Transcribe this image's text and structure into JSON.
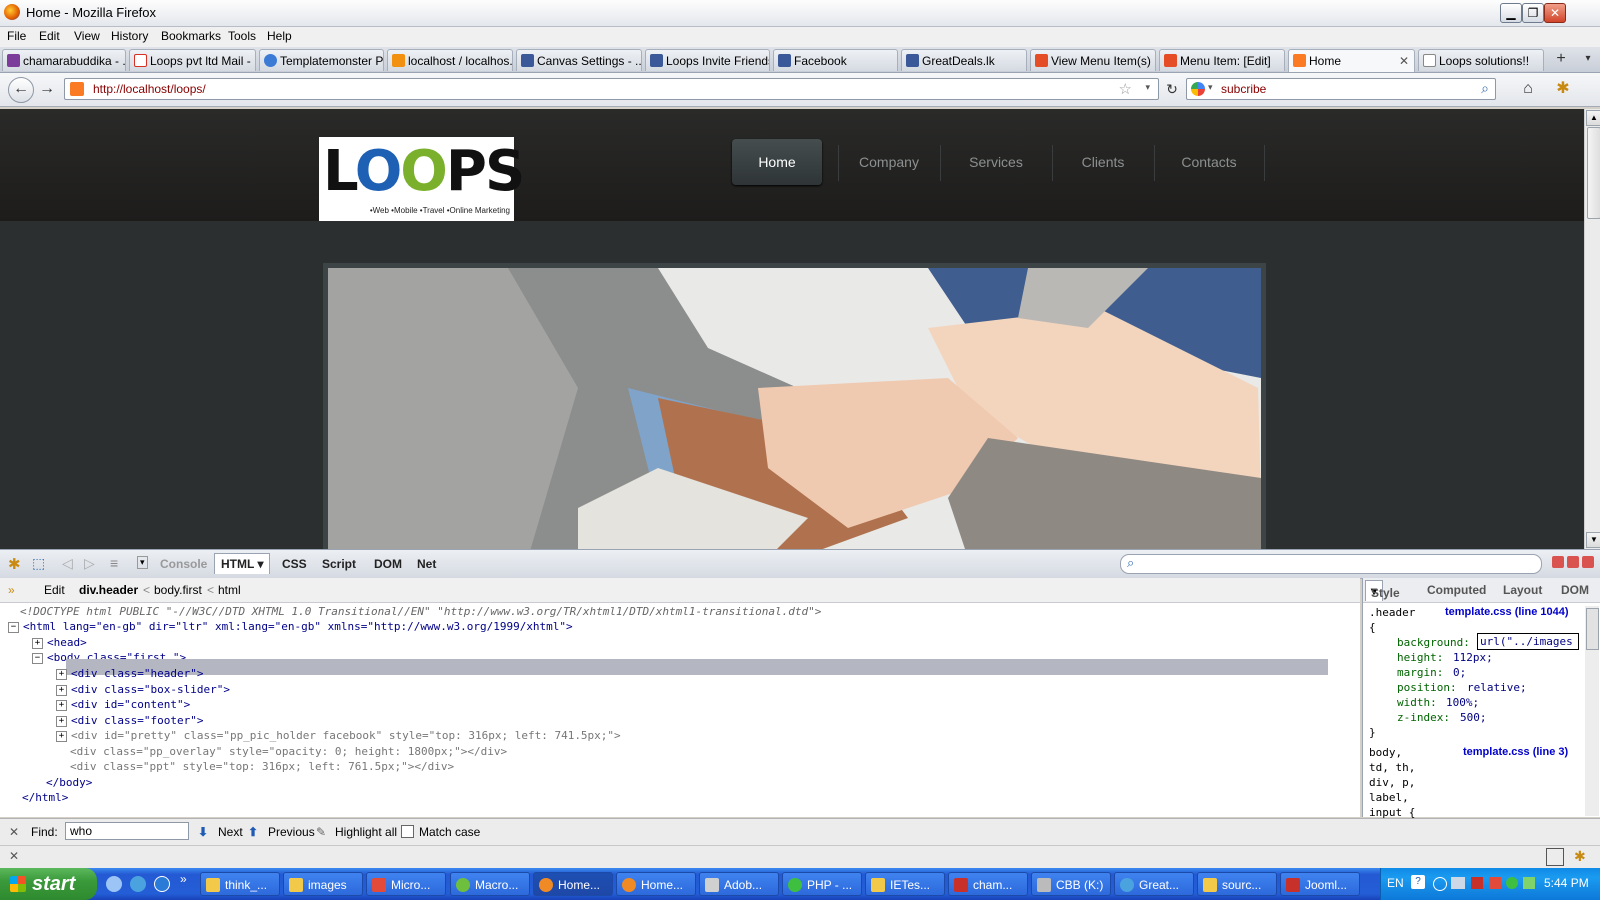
{
  "window": {
    "title": "Home - Mozilla Firefox"
  },
  "menubar": [
    "File",
    "Edit",
    "View",
    "History",
    "Bookmarks",
    "Tools",
    "Help"
  ],
  "tabs": [
    {
      "label": "chamarabuddika - ...",
      "icon": "mail-icon",
      "color": "#7b3d99"
    },
    {
      "label": "Loops pvt ltd Mail - ...",
      "icon": "gmail-icon",
      "color": "#d93025"
    },
    {
      "label": "Templatemonster P...",
      "icon": "templatemonster-icon",
      "color": "#3b7bd6"
    },
    {
      "label": "localhost / localhos...",
      "icon": "phpmyadmin-icon",
      "color": "#f29111"
    },
    {
      "label": "Canvas Settings - ...",
      "icon": "facebook-icon",
      "color": "#3b5998"
    },
    {
      "label": "Loops Invite Friends",
      "icon": "facebook-icon",
      "color": "#3b5998"
    },
    {
      "label": "Facebook",
      "icon": "facebook-icon",
      "color": "#3b5998"
    },
    {
      "label": "GreatDeals.lk",
      "icon": "facebook-icon",
      "color": "#3b5998"
    },
    {
      "label": "View Menu Item(s)",
      "icon": "joomla-icon",
      "color": "#e44d26"
    },
    {
      "label": "Menu Item: [Edit]",
      "icon": "joomla-icon",
      "color": "#e44d26"
    },
    {
      "label": "Home",
      "icon": "xampp-icon",
      "color": "#fb7a24",
      "active": true
    },
    {
      "label": "Loops solutions!!",
      "icon": "page-icon",
      "color": "#ffffff"
    }
  ],
  "navbar": {
    "url": "http://localhost/loops/",
    "search": "subcribe"
  },
  "site": {
    "logo_word": "LOOPS",
    "logo_tagline": "•Web •Mobile •Travel •Online Marketing",
    "nav": [
      "Home",
      "Company",
      "Services",
      "Clients",
      "Contacts"
    ]
  },
  "firebug": {
    "panels": [
      "Console",
      "HTML",
      "CSS",
      "Script",
      "DOM",
      "Net"
    ],
    "active_panel": "HTML",
    "breadcrumbs": [
      "Edit",
      "div.header",
      "body.first",
      "html"
    ],
    "side_tabs": [
      "Style",
      "Computed",
      "Layout",
      "DOM"
    ],
    "html_lines": {
      "doctype": "<!DOCTYPE html PUBLIC \"-//W3C//DTD XHTML 1.0 Transitional//EN\" \"http://www.w3.org/TR/xhtml1/DTD/xhtml1-transitional.dtd\">",
      "html_open": "<html lang=\"en-gb\" dir=\"ltr\" xml:lang=\"en-gb\" xmlns=\"http://www.w3.org/1999/xhtml\">",
      "head": "<head>",
      "body_open": "<body class=\"first \">",
      "div_header": "<div class=\"header\">",
      "div_box_slider": "<div class=\"box-slider\">",
      "div_content": "<div id=\"content\">",
      "div_footer": "<div class=\"footer\">",
      "div_pretty": "<div id=\"pretty\" class=\"pp_pic_holder facebook\" style=\"top: 316px; left: 741.5px;\">",
      "div_overlay": "<div class=\"pp_overlay\" style=\"opacity: 0; height: 1800px;\"></div>",
      "div_ppt": "<div class=\"ppt\" style=\"top: 316px; left: 761.5px;\"></div>",
      "body_close": "</body>",
      "html_close": "</html>"
    },
    "css": {
      "selector1": ".header",
      "source1": "template.css (line 1044)",
      "open": "{",
      "rules": [
        {
          "prop": "background:",
          "val": "url(\"../images"
        },
        {
          "prop": "height:",
          "val": "112px;"
        },
        {
          "prop": "margin:",
          "val": "0;"
        },
        {
          "prop": "position:",
          "val": "relative;"
        },
        {
          "prop": "width:",
          "val": "100%;"
        },
        {
          "prop": "z-index:",
          "val": "500;"
        }
      ],
      "close": "}",
      "selector2_lines": [
        "body,",
        "td, th,",
        "div, p,",
        "label,",
        "input {"
      ],
      "source2": "template.css (line 3)"
    }
  },
  "findbar": {
    "label": "Find:",
    "value": "who",
    "next": "Next",
    "previous": "Previous",
    "highlight": "Highlight all",
    "matchcase": "Match case"
  },
  "taskbar": {
    "start": "start",
    "items": [
      "think_...",
      "images",
      "Micro...",
      "Macro...",
      "Home...",
      "Home...",
      "Adob...",
      "PHP - ...",
      "IETes...",
      "cham...",
      "CBB (K:)",
      "Great...",
      "sourc...",
      "Jooml..."
    ],
    "active_index": 4,
    "lang": "EN",
    "clock": "5:44 PM"
  }
}
